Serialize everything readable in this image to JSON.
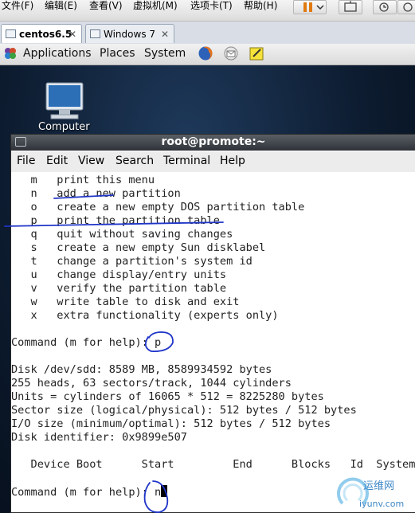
{
  "vm_menubar": {
    "items": [
      "文件(F)",
      "编辑(E)",
      "查看(V)",
      "虚拟机(M)",
      "选项卡(T)",
      "帮助(H)"
    ]
  },
  "vm_tabs": [
    {
      "label": "centos6.5",
      "active": true,
      "icon": "vm-icon"
    },
    {
      "label": "Windows 7",
      "active": false,
      "icon": "vm-icon"
    }
  ],
  "gnome_panel": {
    "menus": [
      "Applications",
      "Places",
      "System"
    ],
    "launchers": [
      "firefox-icon",
      "mail-icon",
      "note-icon"
    ]
  },
  "desktop": {
    "icons": [
      {
        "label": "Computer",
        "icon": "computer-icon"
      }
    ]
  },
  "terminal": {
    "title": "root@promote:~",
    "menu": [
      "File",
      "Edit",
      "View",
      "Search",
      "Terminal",
      "Help"
    ],
    "lines": [
      "   m   print this menu",
      "   n   add a new partition",
      "   o   create a new empty DOS partition table",
      "   p   print the partition table",
      "   q   quit without saving changes",
      "   s   create a new empty Sun disklabel",
      "   t   change a partition's system id",
      "   u   change display/entry units",
      "   v   verify the partition table",
      "   w   write table to disk and exit",
      "   x   extra functionality (experts only)",
      "",
      "Command (m for help): p",
      "",
      "Disk /dev/sdd: 8589 MB, 8589934592 bytes",
      "255 heads, 63 sectors/track, 1044 cylinders",
      "Units = cylinders of 16065 * 512 = 8225280 bytes",
      "Sector size (logical/physical): 512 bytes / 512 bytes",
      "I/O size (minimum/optimal): 512 bytes / 512 bytes",
      "Disk identifier: 0x9899e507",
      "",
      "   Device Boot      Start         End      Blocks   Id  System",
      "",
      "Command (m for help): n"
    ]
  },
  "colors": {
    "annotation_ink": "#1f35c8",
    "terminal_bg": "#ffffff",
    "title_bar": "#3a3f46"
  }
}
